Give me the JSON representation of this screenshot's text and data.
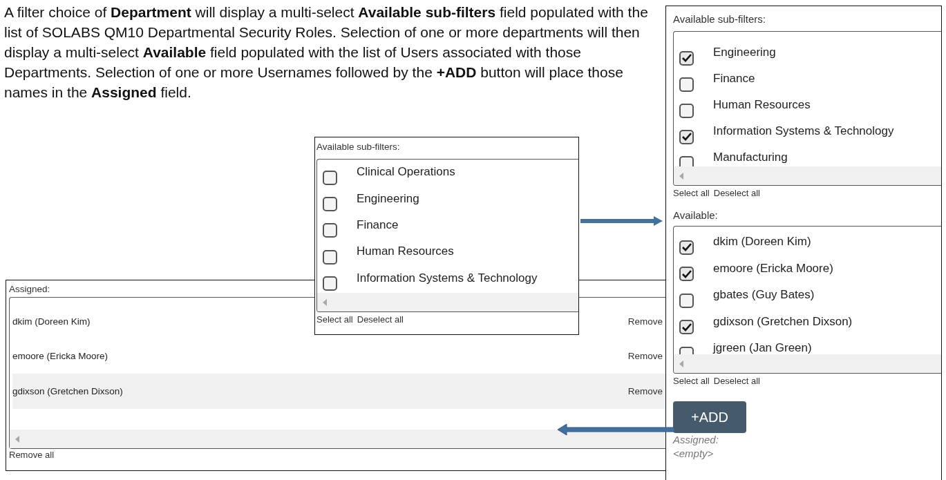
{
  "intro": "A filter choice of **Department** will display a multi-select **Available sub-filters** field populated with the list of SOLABS QM10 Departmental Security Roles. Selection of one or more departments will then display a multi-select **Available** field populated with the list of Users associated with those Departments. Selection of one or more Usernames followed by the **+ADD** button will place those names in the **Assigned** field.",
  "subfilter_panel": {
    "title": "Available sub-filters:",
    "options": [
      {
        "label": "Clinical Operations",
        "checked": false
      },
      {
        "label": "Engineering",
        "checked": false
      },
      {
        "label": "Finance",
        "checked": false
      },
      {
        "label": "Human Resources",
        "checked": false
      },
      {
        "label": "Information Systems & Technology",
        "checked": false
      }
    ],
    "select_all": "Select all",
    "deselect_all": "Deselect all"
  },
  "assigned_panel": {
    "title": "Assigned:",
    "rows": [
      {
        "name": "dkim (Doreen Kim)",
        "action": "Remove",
        "highlighted": false
      },
      {
        "name": "emoore (Ericka Moore)",
        "action": "Remove",
        "highlighted": false
      },
      {
        "name": "gdixson (Gretchen Dixson)",
        "action": "Remove",
        "highlighted": true
      }
    ],
    "remove_all": "Remove all"
  },
  "right_panel": {
    "subfilters": {
      "title": "Available sub-filters:",
      "options": [
        {
          "label": "Engineering",
          "checked": true
        },
        {
          "label": "Finance",
          "checked": false
        },
        {
          "label": "Human Resources",
          "checked": false
        },
        {
          "label": "Information Systems & Technology",
          "checked": true
        },
        {
          "label": "Manufacturing",
          "checked": false
        }
      ],
      "select_all": "Select all",
      "deselect_all": "Deselect all"
    },
    "available": {
      "title": "Available:",
      "options": [
        {
          "label": "dkim (Doreen Kim)",
          "checked": true
        },
        {
          "label": "emoore (Ericka Moore)",
          "checked": true
        },
        {
          "label": "gbates (Guy Bates)",
          "checked": false
        },
        {
          "label": "gdixson (Gretchen Dixson)",
          "checked": true
        },
        {
          "label": "jgreen (Jan Green)",
          "checked": false
        }
      ],
      "select_all": "Select all",
      "deselect_all": "Deselect all"
    },
    "add_button": "+ADD",
    "assigned_label": "Assigned:",
    "assigned_value": "<empty>"
  }
}
